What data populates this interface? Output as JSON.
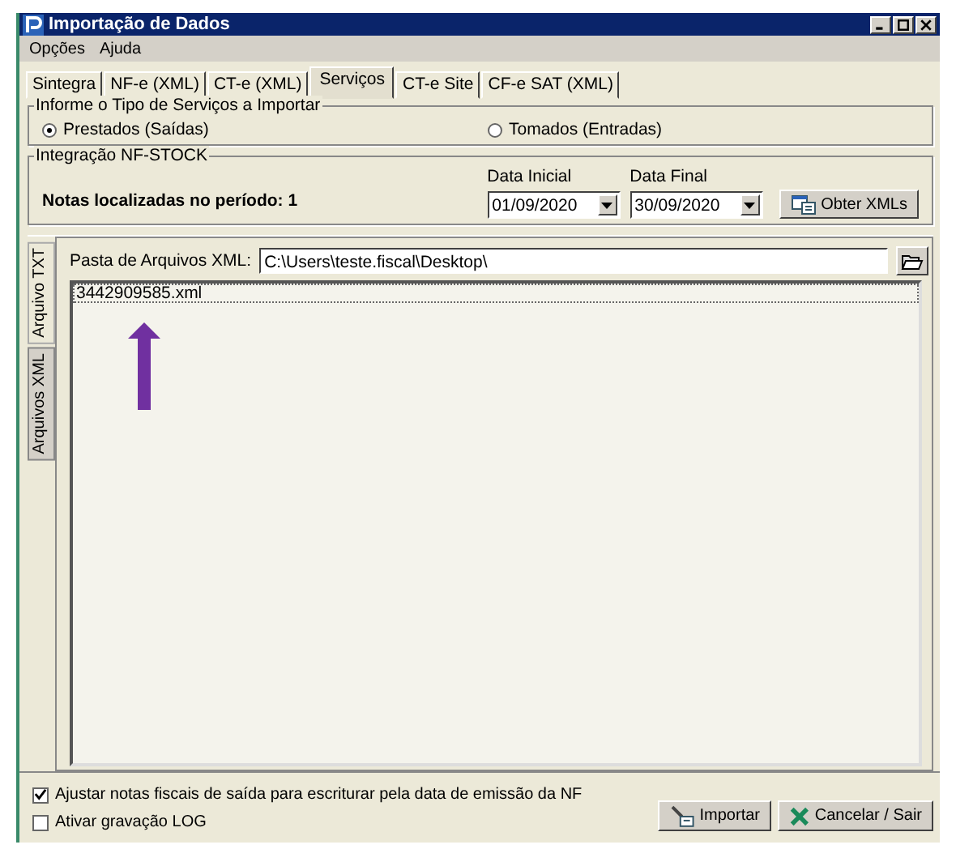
{
  "window": {
    "title": "Importação de Dados"
  },
  "menu": [
    "Opções",
    "Ajuda"
  ],
  "tabs": [
    {
      "label": "Sintegra",
      "selected": false
    },
    {
      "label": "NF-e (XML)",
      "selected": false
    },
    {
      "label": "CT-e (XML)",
      "selected": false
    },
    {
      "label": "Serviços",
      "selected": true
    },
    {
      "label": "CT-e Site",
      "selected": false
    },
    {
      "label": "CF-e SAT (XML)",
      "selected": false
    }
  ],
  "service_type": {
    "legend": "Informe o Tipo de Serviços a Importar",
    "options": [
      {
        "label": "Prestados (Saídas)",
        "selected": true
      },
      {
        "label": "Tomados (Entradas)",
        "selected": false
      }
    ]
  },
  "integration": {
    "legend": "Integração NF-STOCK",
    "found": "Notas localizadas no período: 1",
    "start_label": "Data Inicial",
    "start_value": "01/09/2020",
    "end_label": "Data Final",
    "end_value": "30/09/2020",
    "fetch_button": "Obter XMLs"
  },
  "side_tabs": [
    {
      "label": "Arquivo TXT",
      "selected": false
    },
    {
      "label": "Arquivos XML",
      "selected": true
    }
  ],
  "folder": {
    "label": "Pasta de Arquivos XML:",
    "value": "C:\\Users\\teste.fiscal\\Desktop\\"
  },
  "files": [
    "3442909585.xml"
  ],
  "options": [
    {
      "label": "Ajustar notas fiscais de saída para escriturar pela data de emissão da NF",
      "checked": true
    },
    {
      "label": "Ativar gravação LOG",
      "checked": false
    }
  ],
  "buttons": [
    {
      "kind": "import",
      "label": "Importar"
    },
    {
      "kind": "cancel",
      "label": "Cancelar / Sair"
    }
  ]
}
